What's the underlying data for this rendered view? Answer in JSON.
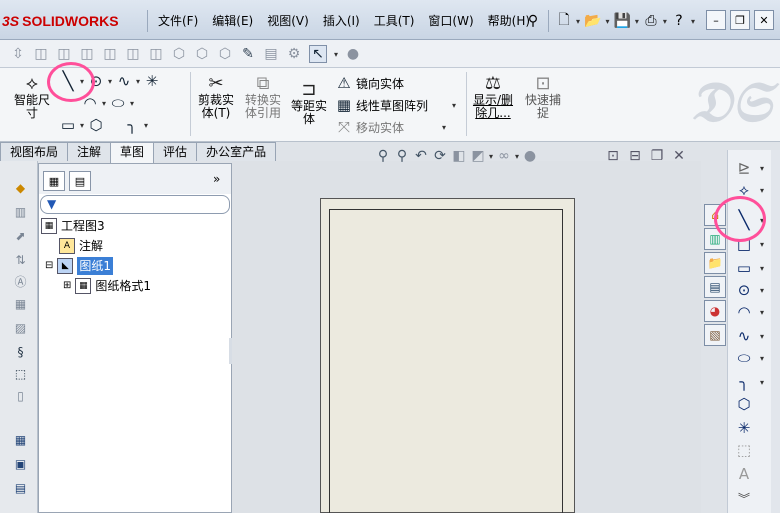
{
  "app": {
    "logo_ds": "3S",
    "logo_name": "SOLIDWORKS"
  },
  "menu": [
    "文件(F)",
    "编辑(E)",
    "视图(V)",
    "插入(I)",
    "工具(T)",
    "窗口(W)",
    "帮助(H)"
  ],
  "quick_icons": [
    "pin-icon",
    "new-doc-icon",
    "open-folder-icon",
    "save-icon",
    "print-icon",
    "help-icon"
  ],
  "command_manager": {
    "smart_dim": "智能尺\n寸",
    "trim": "剪裁实\n体(T)",
    "convert": "转换实\n体引用",
    "offset": "等距实\n体",
    "mirror": "镜向实体",
    "linear_pattern": "线性草图阵列",
    "move": "移动实体",
    "show_delete": "显示/删\n除几...",
    "quick_snap": "快速捕\n捉"
  },
  "tabs": [
    "视图布局",
    "注解",
    "草图",
    "评估",
    "办公室产品"
  ],
  "active_tab": "草图",
  "tree": {
    "root": "工程图3",
    "annotations": "注解",
    "sheet": "图纸1",
    "sheet_format": "图纸格式1"
  },
  "highlight_color": "#ff4f9a"
}
